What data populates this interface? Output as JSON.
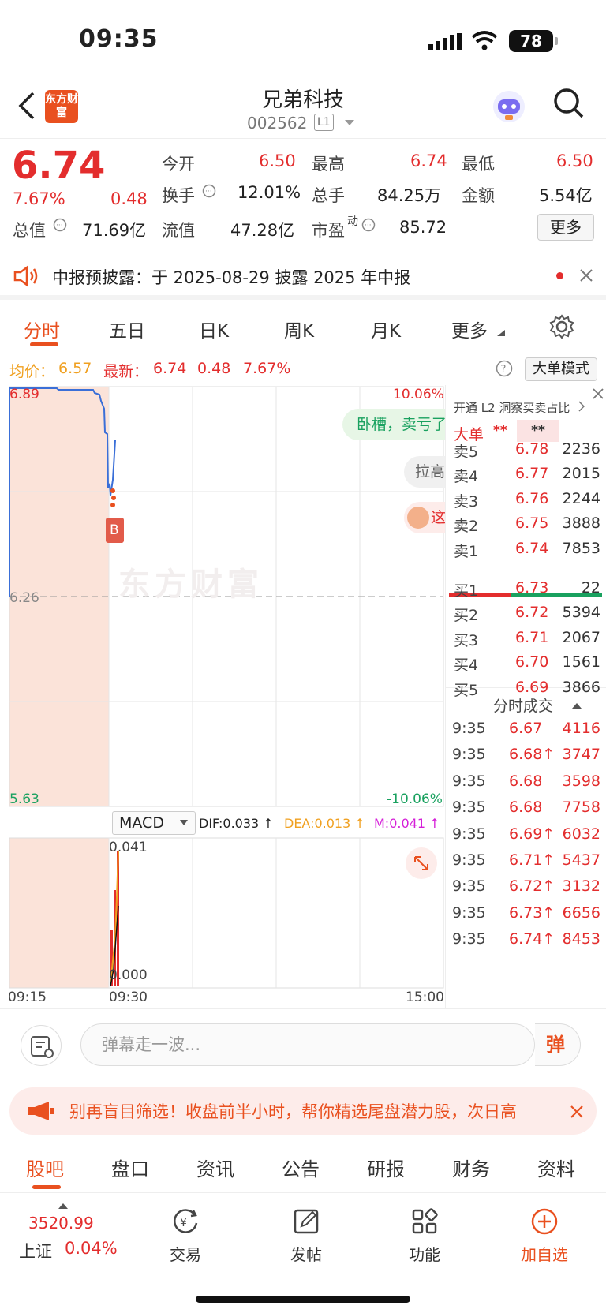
{
  "status": {
    "time": "09:35",
    "battery": "78"
  },
  "header": {
    "logo": "东方财富",
    "name": "兄弟科技",
    "code": "002562",
    "level": "L1"
  },
  "quote": {
    "price": "6.74",
    "change_pct": "7.67%",
    "change": "0.48",
    "open_label": "今开",
    "open": "6.50",
    "high_label": "最高",
    "high": "6.74",
    "low_label": "最低",
    "low": "6.50",
    "turnover_label": "换手",
    "turnover": "12.01%",
    "volume_label": "总手",
    "volume": "84.25万",
    "amount_label": "金额",
    "amount": "5.54亿",
    "mktcap_label": "总值",
    "mktcap": "71.69亿",
    "float_label": "流值",
    "float": "47.28亿",
    "pe_label": "市盈",
    "pe_sup": "动",
    "pe": "85.72",
    "more": "更多"
  },
  "notice": {
    "text": "中报预披露：于 2025-08-29 披露 2025 年中报"
  },
  "chart_tabs": {
    "t1": "分时",
    "t2": "五日",
    "t3": "日K",
    "t4": "周K",
    "t5": "月K",
    "t6": "更多"
  },
  "info_row": {
    "avg_label": "均价：",
    "avg": "6.57",
    "latest_label": "最新：",
    "latest": "6.74",
    "change": "0.48",
    "pct": "7.67%",
    "bigorder": "大单模式"
  },
  "chart": {
    "price_top": "6.89",
    "price_mid": "6.26",
    "price_bot": "5.63",
    "pct_top": "10.06%",
    "pct_bot": "-10.06%",
    "watermark": "东方财富",
    "bubble1": "卧槽，卖亏了",
    "bubble2": "拉高",
    "bubble3": "这",
    "buy_marker": "B",
    "macd_select": "MACD",
    "dif": "DIF:0.033 ↑",
    "dea": "DEA:0.013 ↑",
    "m": "M:0.041 ↑",
    "macd_top": "0.041",
    "macd_bot": "0.000",
    "t_start": "09:15",
    "t_mid": "09:30",
    "t_end": "15:00",
    "colors": {
      "up": "#e32d2d",
      "down": "#19a15f",
      "line": "#3a6fd8",
      "accent": "#e9501f"
    }
  },
  "orderbook": {
    "l2_hint": "开通 L2 洞察买卖占比",
    "big_label": "大单",
    "big_v1": "**",
    "big_v2": "**",
    "asks": [
      {
        "label": "卖5",
        "price": "6.78",
        "vol": "2236"
      },
      {
        "label": "卖4",
        "price": "6.77",
        "vol": "2015"
      },
      {
        "label": "卖3",
        "price": "6.76",
        "vol": "2244"
      },
      {
        "label": "卖2",
        "price": "6.75",
        "vol": "3888"
      },
      {
        "label": "卖1",
        "price": "6.74",
        "vol": "7853"
      }
    ],
    "bids": [
      {
        "label": "买1",
        "price": "6.73",
        "vol": "22"
      },
      {
        "label": "买2",
        "price": "6.72",
        "vol": "5394"
      },
      {
        "label": "买3",
        "price": "6.71",
        "vol": "2067"
      },
      {
        "label": "买4",
        "price": "6.70",
        "vol": "1561"
      },
      {
        "label": "买5",
        "price": "6.69",
        "vol": "3866"
      }
    ],
    "ticks_title": "分时成交",
    "ticks": [
      {
        "t": "9:35",
        "price": "6.67",
        "vol": "4116"
      },
      {
        "t": "9:35",
        "price": "6.68↑",
        "vol": "3747"
      },
      {
        "t": "9:35",
        "price": "6.68",
        "vol": "3598"
      },
      {
        "t": "9:35",
        "price": "6.68",
        "vol": "7758"
      },
      {
        "t": "9:35",
        "price": "6.69↑",
        "vol": "6032"
      },
      {
        "t": "9:35",
        "price": "6.71↑",
        "vol": "5437"
      },
      {
        "t": "9:35",
        "price": "6.72↑",
        "vol": "3132"
      },
      {
        "t": "9:35",
        "price": "6.73↑",
        "vol": "6656"
      },
      {
        "t": "9:35",
        "price": "6.74↑",
        "vol": "8453"
      }
    ]
  },
  "danmu": {
    "placeholder": "弹幕走一波...",
    "send": "弹"
  },
  "promo": {
    "text": "别再盲目筛选！收盘前半小时，帮你精选尾盘潜力股，次日高"
  },
  "sub_tabs": [
    "股吧",
    "盘口",
    "资讯",
    "公告",
    "研报",
    "财务",
    "资料"
  ],
  "bottombar": {
    "index_value": "3520.99",
    "index_name": "上证",
    "index_pct": "0.04%",
    "trade": "交易",
    "post": "发帖",
    "func": "功能",
    "watch": "加自选"
  }
}
